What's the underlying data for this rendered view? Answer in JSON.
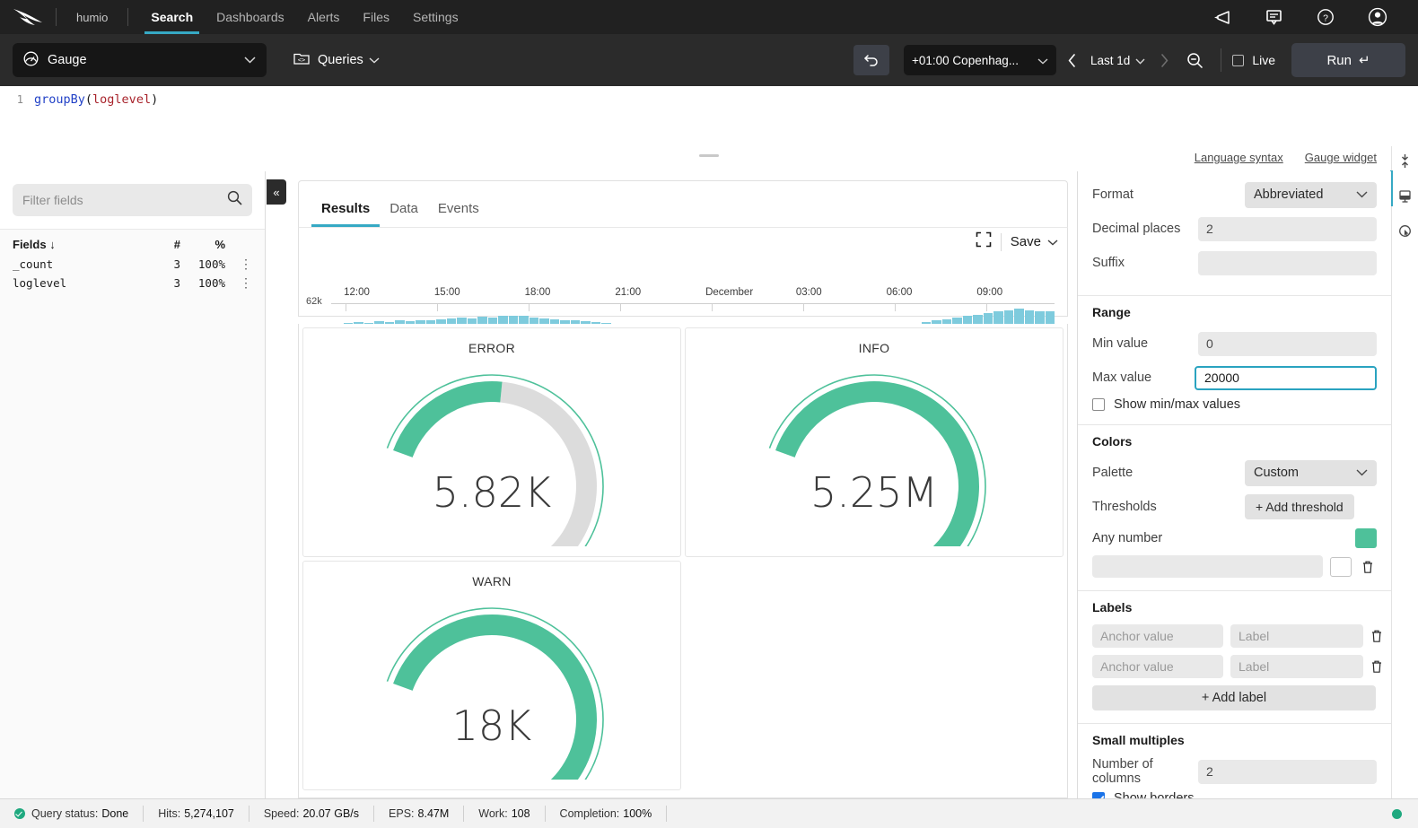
{
  "topnav": {
    "logo_icon": "falcon-logo-icon",
    "org": "humio",
    "items": [
      {
        "label": "Search",
        "active": true
      },
      {
        "label": "Dashboards",
        "active": false
      },
      {
        "label": "Alerts",
        "active": false
      },
      {
        "label": "Files",
        "active": false
      },
      {
        "label": "Settings",
        "active": false
      }
    ],
    "right_icons": [
      "megaphone-icon",
      "chat-icon",
      "help-icon",
      "account-icon"
    ]
  },
  "toolbar": {
    "widget_type": "Gauge",
    "widget_icon": "gauge-icon",
    "queries_label": "Queries",
    "queries_icon": "queries-folder-icon",
    "revert_icon": "revert-icon",
    "timezone": "+01:00 Copenhag...",
    "prev_icon": "chevron-left-icon",
    "time_range": "Last 1d",
    "next_icon": "chevron-right-icon",
    "zoom_out_icon": "zoom-out-icon",
    "live_label": "Live",
    "live_checked": false,
    "run_label": "Run",
    "run_glyph": "↵"
  },
  "editor": {
    "line_number": "1",
    "tokens": {
      "fn": "groupBy",
      "open": "(",
      "field": "loglevel",
      "close": ")"
    }
  },
  "links": {
    "language_syntax": "Language syntax",
    "gauge_widget": "Gauge widget"
  },
  "rail": {
    "icons": [
      "collapse-vertical-icon",
      "widget-icon",
      "inspect-icon"
    ]
  },
  "fields_panel": {
    "filter_placeholder": "Filter fields",
    "search_icon": "search-icon",
    "collapse_icon": "«",
    "headers": {
      "name": "Fields",
      "sort_glyph": "↓",
      "count": "#",
      "percent": "%"
    },
    "rows": [
      {
        "name": "_count",
        "count": "3",
        "percent": "100%"
      },
      {
        "name": "loglevel",
        "count": "3",
        "percent": "100%"
      }
    ]
  },
  "results": {
    "tabs": [
      {
        "label": "Results",
        "active": true
      },
      {
        "label": "Data",
        "active": false
      },
      {
        "label": "Events",
        "active": false
      }
    ],
    "expand_icon": "expand-icon",
    "save_label": "Save"
  },
  "chart_data": [
    {
      "type": "bar",
      "title": "",
      "ylabel": "62k",
      "xlabel": "",
      "ticks": [
        "12:00",
        "15:00",
        "18:00",
        "21:00",
        "December",
        "03:00",
        "06:00",
        "09:00"
      ],
      "tick_positions": [
        0.02,
        0.145,
        0.27,
        0.395,
        0.52,
        0.645,
        0.77,
        0.895
      ],
      "ylim": [
        0,
        62000
      ],
      "bar_color": "#7ecbdd",
      "values": [
        32,
        41,
        42,
        41,
        43,
        42,
        44,
        43,
        45,
        44,
        46,
        47,
        48,
        47,
        49,
        48,
        50,
        51,
        50,
        48,
        47,
        46,
        45,
        44,
        43,
        42,
        41,
        40,
        39,
        38,
        37,
        36,
        35,
        34,
        33,
        32,
        31,
        30,
        30,
        29,
        29,
        28,
        28,
        29,
        29,
        30,
        30,
        31,
        31,
        32,
        33,
        34,
        35,
        36,
        37,
        38,
        40,
        42,
        44,
        46,
        48,
        50,
        52,
        54,
        56,
        58,
        60,
        58,
        57,
        56
      ],
      "grid": false,
      "legend": "none"
    },
    {
      "type": "gauge",
      "title": "ERROR",
      "display_value": "5.82K",
      "value": 5820,
      "min": 0,
      "max": 20000,
      "fill_fraction": 0.291,
      "fill_color": "#4ec19a",
      "track_color": "#dcdcdc"
    },
    {
      "type": "gauge",
      "title": "INFO",
      "display_value": "5.25M",
      "value": 5250000,
      "min": 0,
      "max": 20000,
      "fill_fraction": 1.0,
      "fill_color": "#4ec19a",
      "track_color": "#dcdcdc"
    },
    {
      "type": "gauge",
      "title": "WARN",
      "display_value": "18K",
      "value": 18000,
      "min": 0,
      "max": 20000,
      "fill_fraction": 0.9,
      "fill_color": "#4ec19a",
      "track_color": "#dcdcdc"
    }
  ],
  "settings": {
    "format": {
      "label": "Format",
      "value": "Abbreviated",
      "decimal_label": "Decimal places",
      "decimal_value": "2",
      "suffix_label": "Suffix",
      "suffix_value": ""
    },
    "range": {
      "title": "Range",
      "min_label": "Min value",
      "min_value": "0",
      "max_label": "Max value",
      "max_value": "20000",
      "show_minmax_label": "Show min/max values",
      "show_minmax_checked": false
    },
    "colors": {
      "title": "Colors",
      "palette_label": "Palette",
      "palette_value": "Custom",
      "thresholds_label": "Thresholds",
      "add_threshold_label": "+ Add threshold",
      "any_number_label": "Any number",
      "any_number_color": "#4ec19a",
      "new_threshold_color": "#ffffff",
      "delete_icon": "trash-icon"
    },
    "labels": {
      "title": "Labels",
      "anchor_placeholder": "Anchor value",
      "label_placeholder": "Label",
      "rows": [
        {
          "anchor": "",
          "label": ""
        },
        {
          "anchor": "",
          "label": ""
        }
      ],
      "add_label": "+ Add label",
      "delete_icon": "trash-icon"
    },
    "small_multiples": {
      "title": "Small multiples",
      "columns_label": "Number of columns",
      "columns_value": "2",
      "show_borders_label": "Show borders",
      "show_borders_checked": true
    }
  },
  "statusbar": {
    "status_label": "Query status:",
    "status_value": "Done",
    "hits_label": "Hits:",
    "hits_value": "5,274,107",
    "speed_label": "Speed:",
    "speed_value": "20.07 GB/s",
    "eps_label": "EPS:",
    "eps_value": "8.47M",
    "work_label": "Work:",
    "work_value": "108",
    "completion_label": "Completion:",
    "completion_value": "100%"
  }
}
